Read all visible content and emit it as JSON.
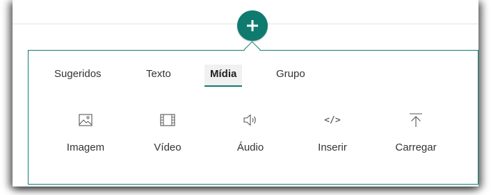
{
  "add_button": {
    "icon": "plus-icon",
    "color": "#0f7b6f"
  },
  "tabs": [
    {
      "label": "Sugeridos",
      "active": false
    },
    {
      "label": "Texto",
      "active": false
    },
    {
      "label": "Mídia",
      "active": true
    },
    {
      "label": "Grupo",
      "active": false
    }
  ],
  "tools": [
    {
      "label": "Imagem",
      "icon": "image-icon"
    },
    {
      "label": "Vídeo",
      "icon": "film-icon"
    },
    {
      "label": "Áudio",
      "icon": "speaker-icon"
    },
    {
      "label": "Inserir",
      "icon": "embed-code-icon",
      "glyph": "</>"
    },
    {
      "label": "Carregar",
      "icon": "upload-icon"
    }
  ],
  "colors": {
    "accent": "#0f7b6f",
    "text": "#333333"
  }
}
